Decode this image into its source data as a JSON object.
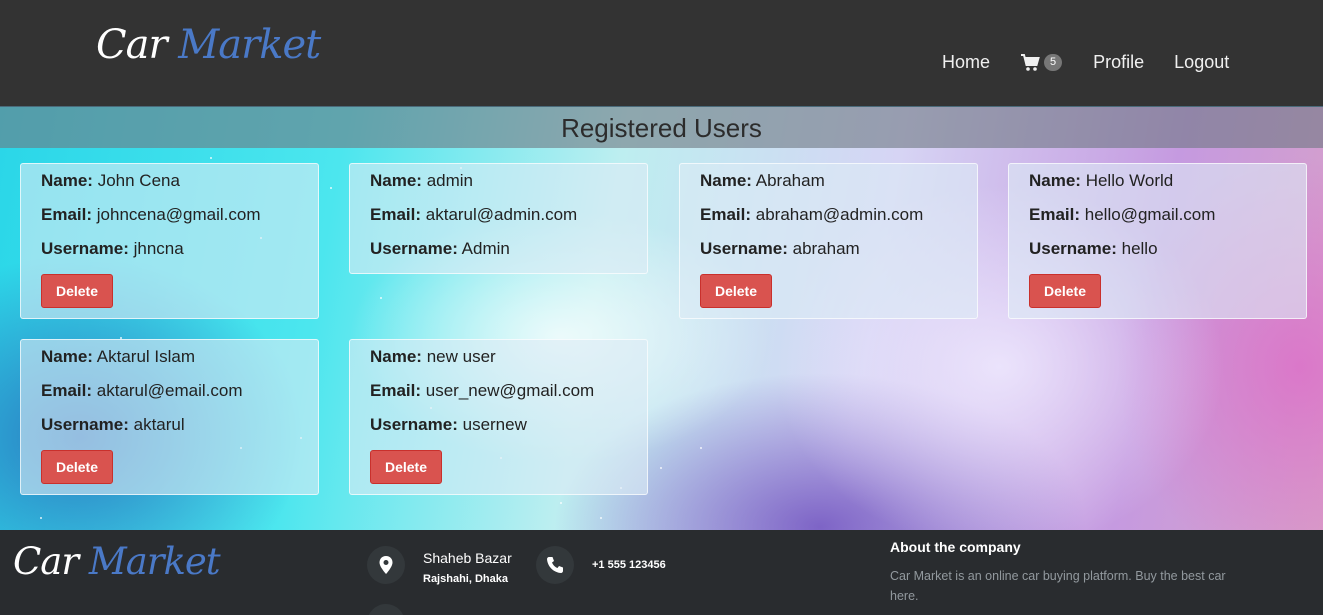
{
  "header": {
    "logo": {
      "word1": "Car",
      "word2": "Market"
    },
    "nav": {
      "home": "Home",
      "cart_count": "5",
      "profile": "Profile",
      "logout": "Logout"
    }
  },
  "page": {
    "title": "Registered Users"
  },
  "labels": {
    "name": "Name:",
    "email": "Email:",
    "username": "Username:",
    "delete": "Delete"
  },
  "users": [
    {
      "name": "John Cena",
      "email": "johncena@gmail.com",
      "username": "jhncna",
      "deletable": true
    },
    {
      "name": "admin",
      "email": "aktarul@admin.com",
      "username": "Admin",
      "deletable": false
    },
    {
      "name": "Abraham",
      "email": "abraham@admin.com",
      "username": "abraham",
      "deletable": true
    },
    {
      "name": "Hello World",
      "email": "hello@gmail.com",
      "username": "hello",
      "deletable": true
    },
    {
      "name": "Aktarul Islam",
      "email": "aktarul@email.com",
      "username": "aktarul",
      "deletable": true
    },
    {
      "name": "new user",
      "email": "user_new@gmail.com",
      "username": "usernew",
      "deletable": true
    }
  ],
  "footer": {
    "logo": {
      "word1": "Car",
      "word2": "Market"
    },
    "address_line1": "Shaheb Bazar",
    "address_line2": "Rajshahi, Dhaka",
    "phone": "+1 555 123456",
    "about_heading": "About the company",
    "about_text": "Car Market is an online car buying platform. Buy the best car here."
  },
  "colors": {
    "brand_blue": "#4a79c7",
    "danger": "#d9534f",
    "header_bg": "#333333"
  },
  "icons": [
    "cart-icon",
    "map-marker-icon",
    "phone-icon"
  ]
}
